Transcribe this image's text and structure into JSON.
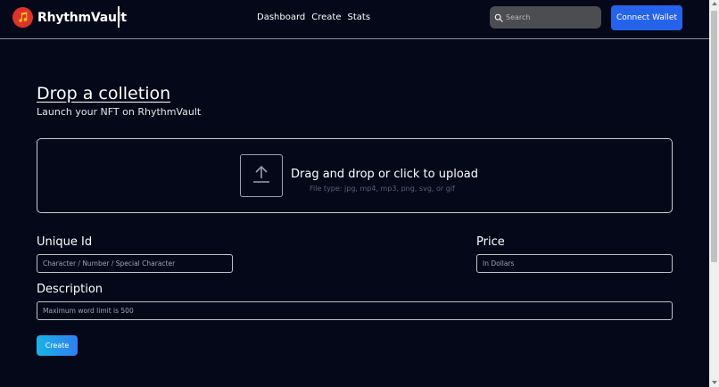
{
  "app": {
    "name": "RhythmVault"
  },
  "nav": {
    "links": [
      "Dashboard",
      "Create",
      "Stats"
    ]
  },
  "search": {
    "placeholder": "Search"
  },
  "connect_wallet": {
    "label": "Connect Wallet"
  },
  "form": {
    "title": "Drop a colletion",
    "subtitle": "Launch your NFT on RhythmVault",
    "upload": {
      "title": "Drag and drop or click to upload",
      "hint": "File type: jpg, mp4, mp3, png, svg, or gif"
    },
    "unique_id": {
      "label": "Unique Id",
      "placeholder": "Character / Number / Special Character"
    },
    "price": {
      "label": "Price",
      "placeholder": "In Dollars"
    },
    "description": {
      "label": "Description",
      "placeholder": "Maximum word limit is 500"
    },
    "create_label": "Create"
  },
  "colors": {
    "background": "#040818",
    "accent": "#2563eb",
    "logo": "#e0322b"
  },
  "icons": {
    "logo": "music-note-icon",
    "search": "search-icon",
    "upload": "upload-arrow-icon"
  }
}
